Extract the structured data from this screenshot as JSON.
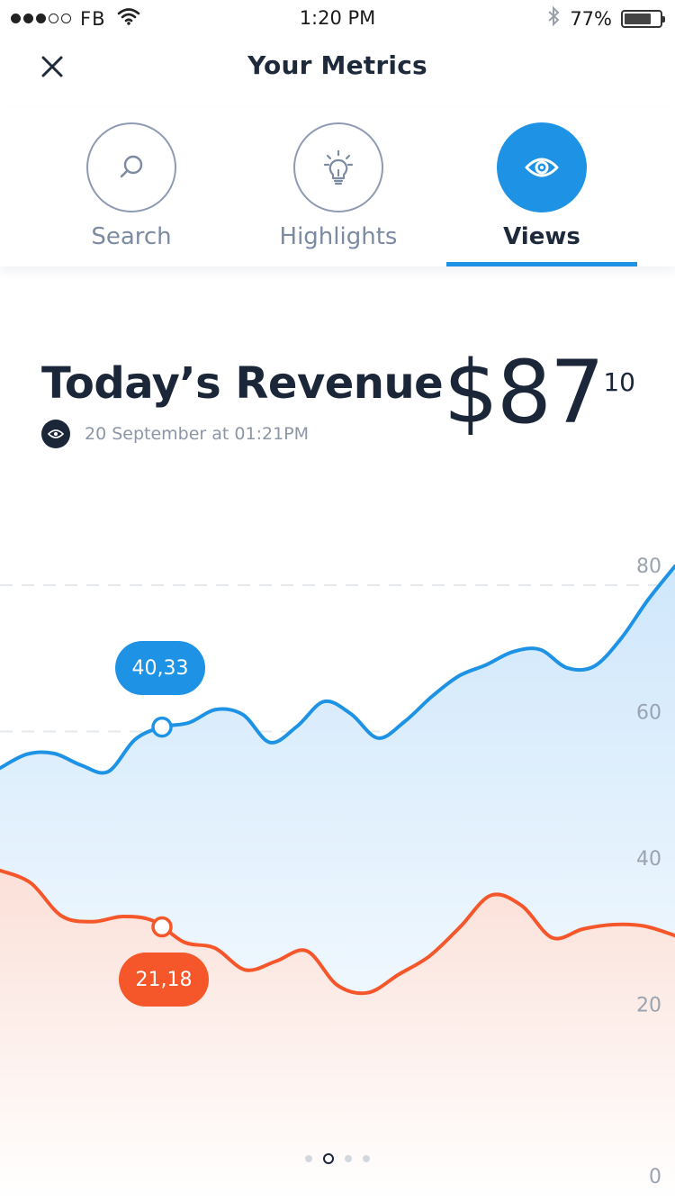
{
  "status_bar": {
    "carrier": "FB",
    "signal_filled": 3,
    "signal_total": 5,
    "time": "1:20 PM",
    "battery": "77%",
    "icons": [
      "wifi-icon",
      "bluetooth-icon",
      "battery-icon"
    ]
  },
  "header": {
    "title": "Your Metrics",
    "close_icon": "close-icon"
  },
  "tabs": [
    {
      "label": "Search",
      "icon": "search-icon",
      "active": false
    },
    {
      "label": "Highlights",
      "icon": "lightbulb-icon",
      "active": false
    },
    {
      "label": "Views",
      "icon": "eye-icon",
      "active": true
    }
  ],
  "revenue": {
    "title": "Today’s Revenue",
    "date": "20 September at 01:21PM",
    "amount": "$87",
    "cents": "10"
  },
  "colors": {
    "accent_blue": "#1e93e6",
    "accent_orange": "#f5572b",
    "text_dark": "#1b2638"
  },
  "chart_data": {
    "type": "area",
    "y_ticks": [
      "80",
      "60",
      "40",
      "20",
      "0"
    ],
    "ylim": [
      0,
      80
    ],
    "grid": true,
    "series": [
      {
        "color": "#1e93e6",
        "values": [
          55,
          56.9,
          57,
          55.4,
          54.5,
          58.9,
          60.6,
          61.2,
          63,
          62.3,
          58.5,
          60.7,
          64.1,
          62.4,
          59.1,
          61.4,
          64.8,
          67.6,
          69.1,
          70.9,
          71.2,
          68.7,
          68.9,
          72.7,
          78,
          82.6
        ],
        "highlight_label": "40,33"
      },
      {
        "color": "#f5572b",
        "values": [
          41,
          39.3,
          34.8,
          34,
          34.7,
          34.1,
          31.2,
          30.4,
          27.4,
          28.6,
          30,
          25.3,
          24.3,
          26.8,
          29.3,
          33.3,
          37.6,
          36.2,
          31.8,
          33,
          33.6,
          33.4,
          32.1
        ],
        "highlight_label": "21,18"
      }
    ]
  },
  "pager": {
    "count": 4,
    "active_index": 1
  }
}
